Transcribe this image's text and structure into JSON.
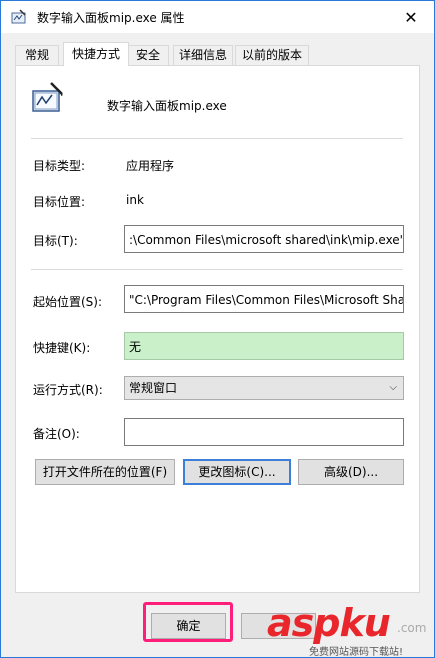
{
  "window": {
    "title": "数字输入面板mip.exe  属性",
    "close_glyph": "✕"
  },
  "tabs": [
    "常规",
    "快捷方式",
    "安全",
    "详细信息",
    "以前的版本"
  ],
  "app_name": "数字输入面板mip.exe",
  "info": {
    "type_label": "目标类型:",
    "type_value": "应用程序",
    "location_label": "目标位置:",
    "location_value": "ink",
    "target_label": "目标(T):",
    "target_value": ":\\Common Files\\microsoft shared\\ink\\mip.exe\""
  },
  "fields": {
    "start_label": "起始位置(S):",
    "start_value": "\"C:\\Program Files\\Common Files\\Microsoft Sha",
    "hotkey_label": "快捷键(K):",
    "hotkey_value": "无",
    "run_label": "运行方式(R):",
    "run_value": "常规窗口",
    "comment_label": "备注(O):",
    "comment_value": ""
  },
  "buttons": {
    "open_location": "打开文件所在的位置(F)",
    "change_icon": "更改图标(C)...",
    "advanced": "高级(D)..."
  },
  "bottom": {
    "ok": "确定"
  },
  "watermark": {
    "brand": "aspku",
    "suffix": ".com",
    "tagline": "免费网站源码下载站!"
  },
  "colors": {
    "accent": "#3c7fd8",
    "highlight": "#ff1f7a",
    "hotkey_bg": "#c9f0c9",
    "watermark": "#e8262b"
  }
}
